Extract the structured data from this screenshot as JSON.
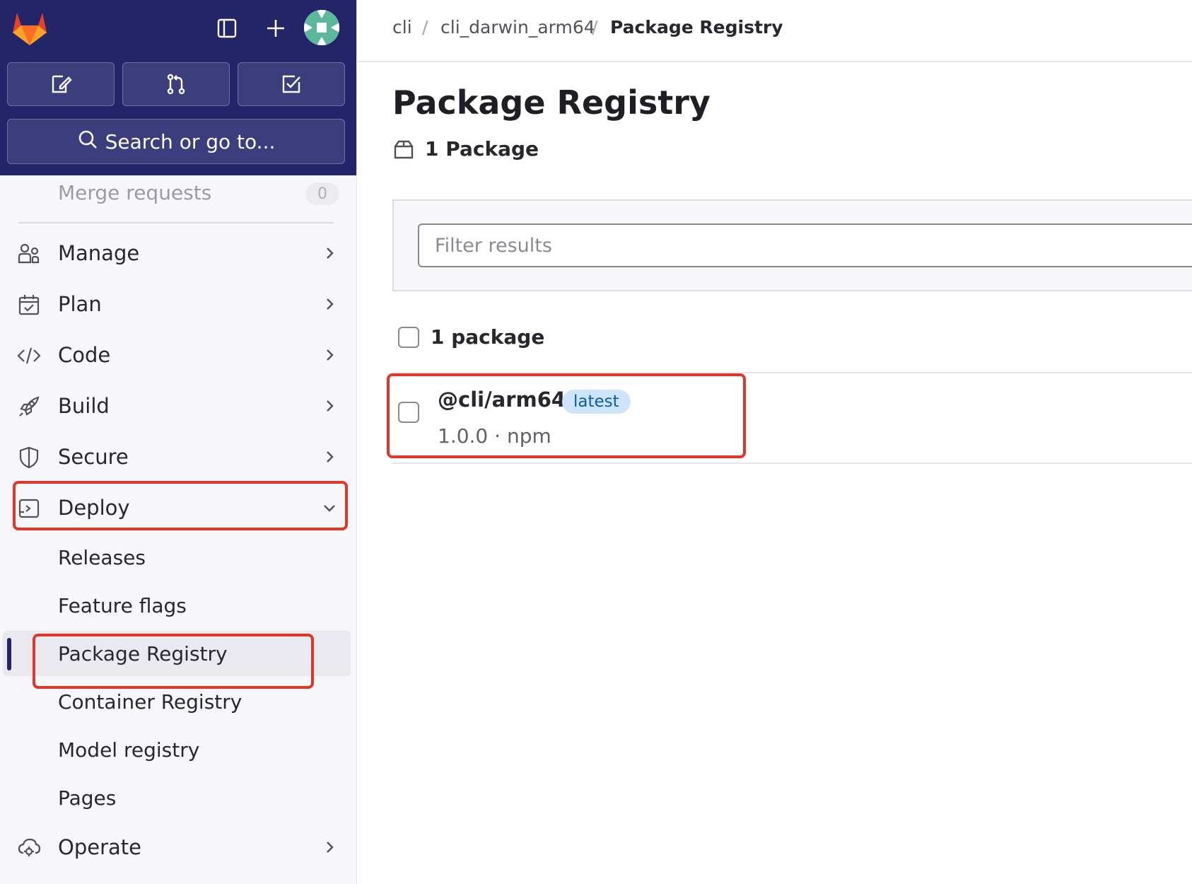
{
  "sidebar": {
    "search_label": "Search or go to...",
    "merge_requests": {
      "label": "Merge requests",
      "count": "0"
    },
    "items": [
      {
        "label": "Manage"
      },
      {
        "label": "Plan"
      },
      {
        "label": "Code"
      },
      {
        "label": "Build"
      },
      {
        "label": "Secure"
      },
      {
        "label": "Deploy"
      },
      {
        "label": "Operate"
      }
    ],
    "deploy_sub": [
      {
        "label": "Releases"
      },
      {
        "label": "Feature flags"
      },
      {
        "label": "Package Registry"
      },
      {
        "label": "Container Registry"
      },
      {
        "label": "Model registry"
      },
      {
        "label": "Pages"
      }
    ],
    "active_item": "Package Registry"
  },
  "breadcrumb": [
    "cli",
    "cli_darwin_arm64",
    "Package Registry"
  ],
  "page": {
    "title": "Package Registry",
    "package_count": "1 Package",
    "filter_placeholder": "Filter results",
    "list_header": "1 package",
    "packages": [
      {
        "name": "@cli/arm64",
        "badge": "latest",
        "meta": "1.0.0 · npm"
      }
    ]
  },
  "colors": {
    "sidebar_top": "#242469",
    "sidebar_bg": "#f7f7fb",
    "highlight": "#e0372a",
    "badge_bg": "#cfe4fa",
    "badge_text": "#0b5cad"
  }
}
